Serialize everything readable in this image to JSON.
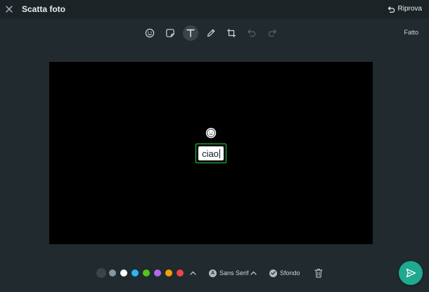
{
  "header": {
    "title": "Scatta foto",
    "retry_label": "Riprova"
  },
  "toolbar": {
    "tools": [
      {
        "name": "emoji-tool",
        "icon": "smiley-icon"
      },
      {
        "name": "sticker-tool",
        "icon": "sticker-icon"
      },
      {
        "name": "text-tool",
        "icon": "text-t-icon",
        "active": true
      },
      {
        "name": "draw-tool",
        "icon": "pencil-icon"
      },
      {
        "name": "crop-tool",
        "icon": "crop-icon"
      },
      {
        "name": "undo-tool",
        "icon": "undo-icon",
        "disabled": true
      },
      {
        "name": "redo-tool",
        "icon": "redo-icon",
        "disabled": true
      }
    ],
    "done_label": "Fatto"
  },
  "canvas": {
    "background": "#000000",
    "text_value": "ciao",
    "selection_color": "#25d33a"
  },
  "bottombar": {
    "colors": [
      "#3b4448",
      "#8696a0",
      "#ffffff",
      "#29b6f6",
      "#52c41a",
      "#b06ae6",
      "#f59e0b",
      "#ef4444"
    ],
    "font_label": "Sans Serif",
    "font_badge": "A",
    "background_label": "Sfondo"
  },
  "theme": {
    "accent": "#1fa98f",
    "panel": "#212a2f",
    "header": "#1b2327"
  }
}
